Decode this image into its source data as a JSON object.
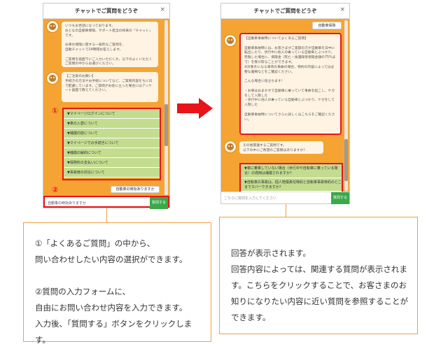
{
  "window_left": {
    "title": "チャットでご質問をどうぞ",
    "close": "×",
    "greeting": "いつもお世話になっております。\nおとなの自動車保険、サポート担当の将来の「チャット」です。\n\nお車の保険に関する一般的なご質問を、\n自動チャットで24時間お答えします。\n\nご質問を画面下にご入力いただくか、以下のよくいただくご質問の中からお選びください。",
    "notice": "【ご注意のお願い】\n手続きの方法やお手続についてなど、ご質問内容をちに日で配慮しています。ご質問がお役に立った場合にはアンケート画面で教えてください。",
    "options": [
      "▼マイページログインについて",
      "▼車の入替について",
      "▼補償内容について",
      "▼マイページでの手続きについて",
      "▼補償の解約について",
      "▼保険料の支払いについて",
      "▼事故時の対応について"
    ],
    "question_button": "自動車の時効ありますか",
    "input_value": "自動車の時効ありますか",
    "send_label": "質問する",
    "marker1": "①",
    "marker2": "②"
  },
  "window_right": {
    "title": "チャットでご質問をどうぞ",
    "close": "×",
    "question_chip": "自動車保険",
    "answer": "【自動車事故時についてよくあるご質問】\n\n自動車事故時には、お客さまがご家族の方が自動車を日中に転出したり、歩行中に他人の乗っている自動車とぶつかり、死傷した場合に、保険金（死亡・後遺障害保険金額の75%まで）を受け取ることができます。\n※対象外になる車両の事故の場合、特約の内容によっては必要な書類などをご確認ください。\n\nこんな場合に役立ちます！\n\n・お車はおまかせで自動車に乗っていて事故を起こし、ケガをして入院した\n・歩行中に他人の乗っている自動車とぶつかり、ケガをして入院した\n\n自動車事故時についてさらに詳しくはこちらをご確認ください。",
    "followup": "その他関連するご質問です。\n以下の中にご希望のご質問はありますか？",
    "related": [
      "▼車に乗車していない場合（歩行中や自転車に乗っている場合）の適用は補償されますか？",
      "▼自転車の事故は、個人賠償責任特約と自転車事故特約のどこまでカバーできますか？"
    ],
    "input_placeholder": "こちらに質問を入力してください",
    "send_label": "質問する"
  },
  "note_left": "①「よくあるご質問」の中から、\n問い合わせしたい内容の選択ができます。\n\n②質問の入力フォームに、\n自由にお問い合わせ内容を入力できます。\n入力後、「質問する」ボタンをクリックします。",
  "note_right": "回答が表示されます。\n回答内容によっては、関連する質問が表示されます。こちらをクリックすることで、お客さまのお知りになりたい内容に近い質問を参照することができます。"
}
